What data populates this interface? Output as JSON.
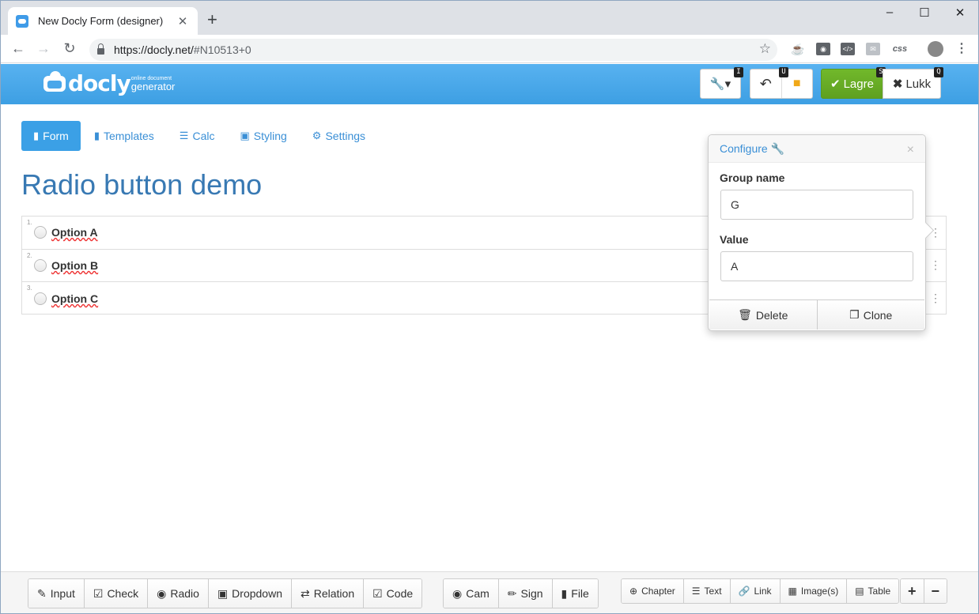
{
  "browser": {
    "tab_title": "New Docly Form (designer)",
    "tab_close": "✕",
    "new_tab": "+",
    "url_host": "https://docly.net/",
    "url_path": "#N10513+0",
    "extensions": [
      "css"
    ]
  },
  "app": {
    "logo_word": "docly",
    "logo_sub1": "online document",
    "logo_sub2": "generator",
    "header_buttons": {
      "tools_kbd": "I",
      "undo_kbd": "U",
      "save_label": "Lagre",
      "save_kbd": "S",
      "close_label": "Lukk",
      "close_kbd": "Q"
    },
    "tabs": [
      {
        "label": "Form",
        "active": true
      },
      {
        "label": "Templates"
      },
      {
        "label": "Calc"
      },
      {
        "label": "Styling"
      },
      {
        "label": "Settings"
      }
    ],
    "page_title": "Radio button demo",
    "rows": [
      {
        "num": "1.",
        "label": "Option A"
      },
      {
        "num": "2.",
        "label": "Option B"
      },
      {
        "num": "3.",
        "label": "Option C"
      }
    ]
  },
  "popover": {
    "title": "Configure",
    "close": "×",
    "group_label": "Group name",
    "group_value": "G",
    "value_label": "Value",
    "value_value": "A",
    "delete_label": "Delete",
    "clone_label": "Clone"
  },
  "bottom": {
    "fields": [
      "Input",
      "Check",
      "Radio",
      "Dropdown",
      "Relation",
      "Code"
    ],
    "media": [
      "Cam",
      "Sign",
      "File"
    ],
    "structure": [
      "Chapter",
      "Text",
      "Link",
      "Image(s)",
      "Table"
    ],
    "zoom": [
      "+",
      "−"
    ]
  },
  "colors": {
    "header_blue": "#4aa7ea",
    "accent_blue": "#3ba0e6",
    "save_green": "#67ac25",
    "title_blue": "#3879b3",
    "comment_yellow": "#f0a818"
  }
}
